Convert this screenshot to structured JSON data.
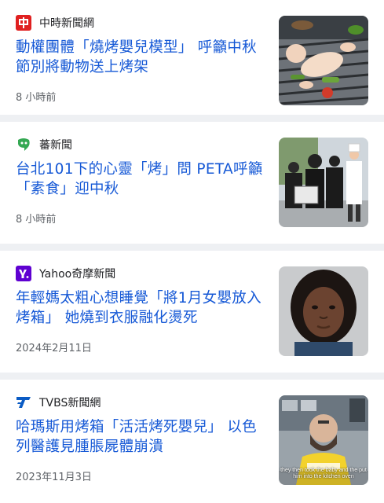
{
  "articles": [
    {
      "source": "中時新聞網",
      "source_icon": "chinatimes-logo-icon",
      "headline": "動權團體「燒烤嬰兒模型」 呼籲中秋節別將動物送上烤架",
      "time": "8 小時前",
      "thumbnail": "baby-doll-on-grill-image"
    },
    {
      "source": "蕃新聞",
      "source_icon": "fannews-logo-icon",
      "headline": "台北101下的心靈「烤」問 PETA呼籲「素食」迎中秋",
      "time": "8 小時前",
      "thumbnail": "peta-protest-chef-image"
    },
    {
      "source": "Yahoo奇摩新聞",
      "source_icon": "yahoo-logo-icon",
      "headline": "年輕媽太粗心想睡覺「將1月女嬰放入烤箱」 她燒到衣服融化燙死",
      "time": "2024年2月11日",
      "thumbnail": "mugshot-woman-image"
    },
    {
      "source": "TVBS新聞網",
      "source_icon": "tvbs-logo-icon",
      "headline": "哈瑪斯用烤箱「活活烤死嬰兒」 以色列醫護見腫脹屍體崩潰",
      "time": "2023年11月3日",
      "thumbnail": "rescue-worker-interview-image",
      "thumbnail_caption": "they then took the baby and the put him into the kitchen oven"
    }
  ],
  "colors": {
    "headline": "#1558d6",
    "chinatimes": "#e02020",
    "fannews": "#34a853",
    "yahoo": "#5f01d1",
    "tvbs": "#0a5bc4"
  }
}
